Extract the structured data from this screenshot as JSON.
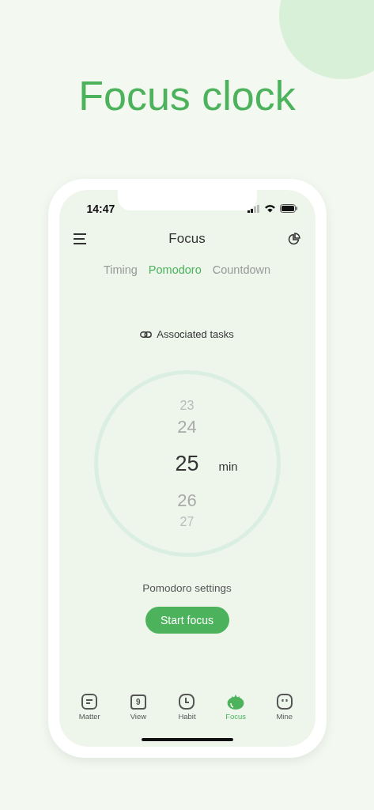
{
  "headline": "Focus clock",
  "status_bar": {
    "time": "14:47"
  },
  "header": {
    "title": "Focus"
  },
  "tabs": [
    {
      "label": "Timing",
      "selected": false
    },
    {
      "label": "Pomodoro",
      "selected": true
    },
    {
      "label": "Countdown",
      "selected": false
    }
  ],
  "associated_tasks": "Associated tasks",
  "picker": {
    "values": [
      {
        "label": "23",
        "selected": false
      },
      {
        "label": "24",
        "selected": false
      },
      {
        "label": "25",
        "selected": true
      },
      {
        "label": "26",
        "selected": false
      },
      {
        "label": "27",
        "selected": false
      }
    ],
    "unit": "min"
  },
  "settings_link": "Pomodoro settings",
  "start_button": "Start focus",
  "bottom_nav": [
    {
      "label": "Matter",
      "kind": "matter",
      "selected": false
    },
    {
      "label": "View",
      "kind": "calendar",
      "icon_text": "9",
      "selected": false
    },
    {
      "label": "Habit",
      "kind": "clock",
      "selected": false
    },
    {
      "label": "Focus",
      "kind": "tomato",
      "selected": true
    },
    {
      "label": "Mine",
      "kind": "face",
      "selected": false
    }
  ]
}
